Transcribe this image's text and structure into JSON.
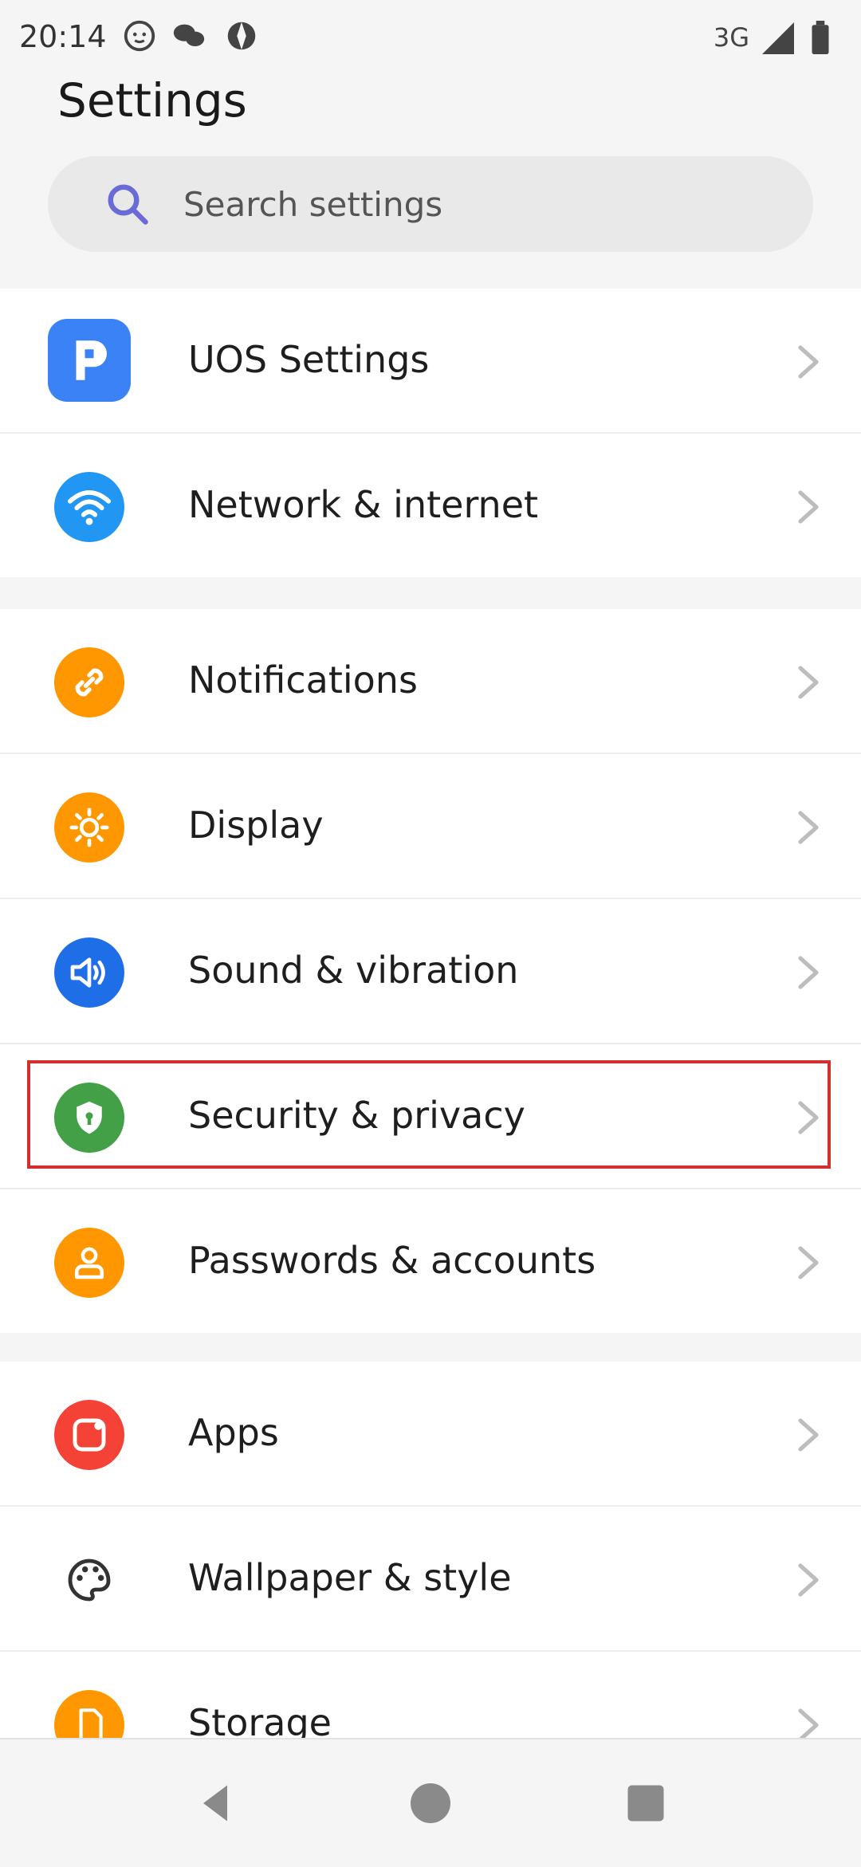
{
  "status_bar": {
    "time": "20:14",
    "network": "3G"
  },
  "page": {
    "title": "Settings"
  },
  "search": {
    "placeholder": "Search settings"
  },
  "groups": [
    {
      "items": [
        {
          "label": "UOS Settings",
          "icon": "uos-icon",
          "color": "#3b82f6"
        },
        {
          "label": "Network & internet",
          "icon": "wifi-icon",
          "color": "#2196f3"
        }
      ]
    },
    {
      "items": [
        {
          "label": "Notifications",
          "icon": "link-icon",
          "color": "#ff9800"
        },
        {
          "label": "Display",
          "icon": "sun-icon",
          "color": "#ff9800"
        },
        {
          "label": "Sound & vibration",
          "icon": "speaker-icon",
          "color": "#1e6ee8"
        },
        {
          "label": "Security & privacy",
          "icon": "shield-icon",
          "color": "#43a047"
        },
        {
          "label": "Passwords & accounts",
          "icon": "user-icon",
          "color": "#ff9800"
        }
      ]
    },
    {
      "items": [
        {
          "label": "Apps",
          "icon": "apps-icon",
          "color": "#f44336"
        },
        {
          "label": "Wallpaper & style",
          "icon": "palette-icon",
          "color": "#ffffff"
        },
        {
          "label": "Storage",
          "icon": "storage-icon",
          "color": "#ff9800"
        }
      ]
    }
  ],
  "highlight_target": "Security & privacy",
  "colors": {
    "accent_highlight": "#d32f2f",
    "background": "#f5f5f5"
  }
}
